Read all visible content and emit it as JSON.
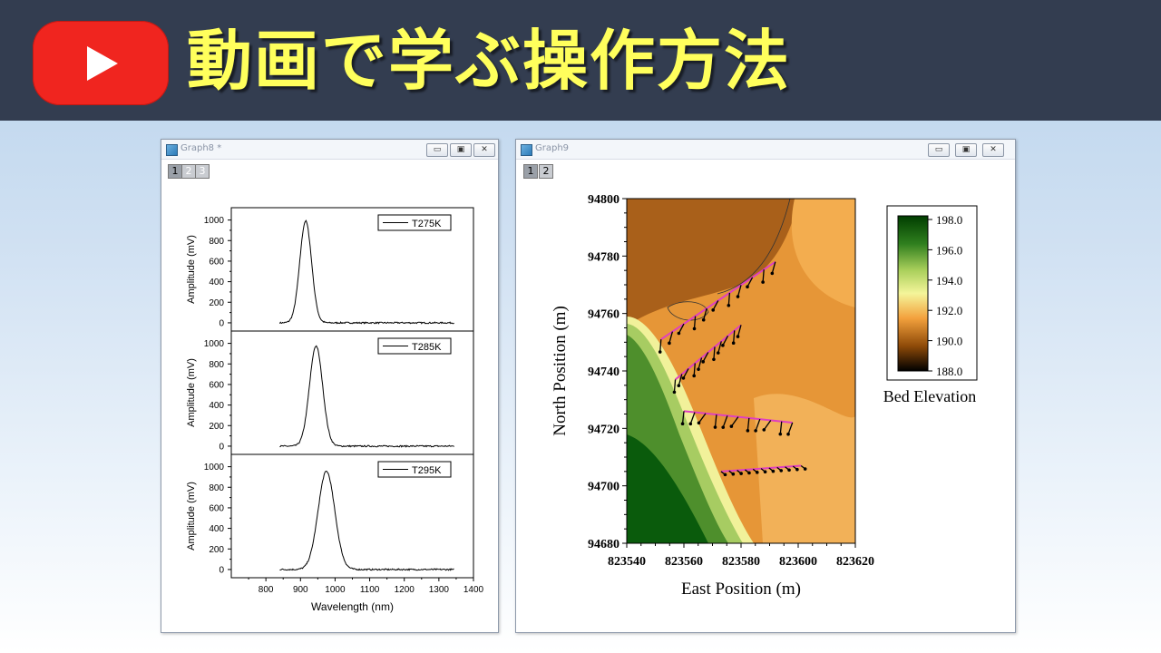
{
  "banner": {
    "logo_icon": "youtube-play-icon",
    "title": "動画で学ぶ操作方法",
    "title_color": "#ffff5c",
    "background": "#333d50"
  },
  "window_left": {
    "title": "Graph8 *",
    "layer_tabs": [
      "1",
      "2",
      "3"
    ],
    "active_tab": "1",
    "buttons": {
      "minimize": "▭",
      "maximize": "▣",
      "close": "✕"
    }
  },
  "window_right": {
    "title": "Graph9",
    "layer_tabs": [
      "1",
      "2"
    ],
    "active_tab": "1",
    "buttons": {
      "minimize": "▭",
      "maximize": "▣",
      "close": "✕"
    }
  },
  "chart_data": [
    {
      "type": "line",
      "xlabel": "Wavelength (nm)",
      "xlim": [
        700,
        1400
      ],
      "x_ticks": [
        800,
        900,
        1000,
        1100,
        1200,
        1300,
        1400
      ],
      "panels": [
        {
          "ylabel": "Amplitude (mV)",
          "ylim": [
            -80,
            1120
          ],
          "y_ticks": [
            0,
            200,
            400,
            600,
            800,
            1000
          ],
          "series": [
            {
              "name": "T275K",
              "x_range": [
                840,
                1345
              ],
              "peak_x": 915,
              "peak_y": 990,
              "sigma": 17
            }
          ]
        },
        {
          "ylabel": "Amplitude (mV)",
          "ylim": [
            -80,
            1120
          ],
          "y_ticks": [
            0,
            200,
            400,
            600,
            800,
            1000
          ],
          "series": [
            {
              "name": "T285K",
              "x_range": [
                840,
                1345
              ],
              "peak_x": 945,
              "peak_y": 975,
              "sigma": 19
            }
          ]
        },
        {
          "ylabel": "Amplitude (mV)",
          "ylim": [
            -80,
            1120
          ],
          "y_ticks": [
            0,
            200,
            400,
            600,
            800,
            1000
          ],
          "series": [
            {
              "name": "T295K",
              "x_range": [
                840,
                1345
              ],
              "peak_x": 975,
              "peak_y": 955,
              "sigma": 24
            }
          ]
        }
      ],
      "legend_position": "top-right"
    },
    {
      "type": "heatmap",
      "xlabel": "East Position (m)",
      "ylabel": "North Position (m)",
      "xlim": [
        823540,
        823620
      ],
      "ylim": [
        94680,
        94800
      ],
      "x_ticks": [
        823540,
        823560,
        823580,
        823600,
        823620
      ],
      "y_ticks": [
        94680,
        94700,
        94720,
        94740,
        94760,
        94780,
        94800
      ],
      "colorbar": {
        "title": "Bed Elevation",
        "range": [
          188.0,
          198.0
        ],
        "ticks": [
          "198.0",
          "196.0",
          "194.0",
          "192.0",
          "190.0",
          "188.0"
        ],
        "position": "right"
      },
      "vector_transects": [
        {
          "x": [
            823552,
            823592
          ],
          "y": [
            94751,
            94778
          ]
        },
        {
          "x": [
            823557,
            823580
          ],
          "y": [
            94737,
            94756
          ]
        },
        {
          "x": [
            823560,
            823598
          ],
          "y": [
            94726,
            94722
          ]
        },
        {
          "x": [
            823573,
            823601
          ],
          "y": [
            94705,
            94707
          ]
        }
      ]
    }
  ]
}
